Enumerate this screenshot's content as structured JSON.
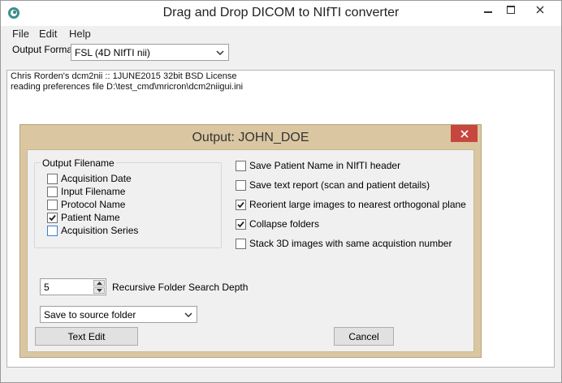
{
  "window": {
    "title": "Drag and Drop DICOM to NIfTI converter",
    "icon": "app-icon"
  },
  "menu": [
    "File",
    "Edit",
    "Help"
  ],
  "output_format": {
    "label": "Output Format:",
    "selected": "FSL (4D NIfTI nii)"
  },
  "log": [
    "Chris Rorden's dcm2nii :: 1JUNE2015 32bit BSD License",
    "reading preferences file D:\\test_cmd\\mricron\\dcm2niigui.ini"
  ],
  "dialog": {
    "title": "Output: JOHN_DOE",
    "output_filename": {
      "title": "Output Filename",
      "options": [
        {
          "label": "Acquisition Date",
          "checked": false
        },
        {
          "label": "Input Filename",
          "checked": false
        },
        {
          "label": "Protocol Name",
          "checked": false
        },
        {
          "label": "Patient Name",
          "checked": true
        },
        {
          "label": "Acquisition Series",
          "checked": false
        }
      ]
    },
    "options": [
      {
        "label": "Save Patient Name in NIfTI header",
        "checked": false
      },
      {
        "label": "Save text report (scan and patient details)",
        "checked": false
      },
      {
        "label": "Reorient large images to nearest orthogonal plane",
        "checked": true
      },
      {
        "label": "Collapse folders",
        "checked": true
      },
      {
        "label": "Stack 3D images with same acquistion number",
        "checked": false
      }
    ],
    "search_depth": {
      "value": "5",
      "label": "Recursive Folder Search Depth"
    },
    "save_location": "Save to source folder",
    "text_edit_label": "Text Edit",
    "cancel_label": "Cancel"
  },
  "colors": {
    "dialog_frame": "#dac7a2",
    "close_button": "#c7463d"
  }
}
